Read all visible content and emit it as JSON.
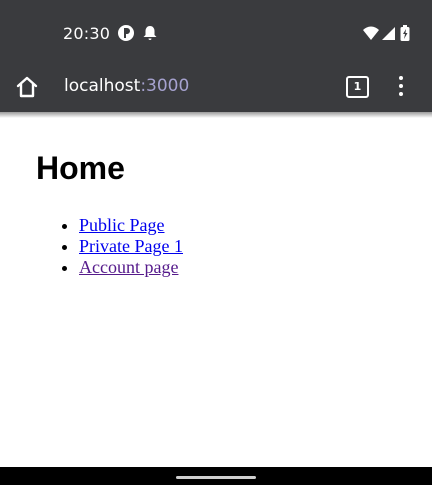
{
  "status_bar": {
    "time": "20:30",
    "icons": [
      "mobile-data-icon",
      "notification-bell-icon",
      "wifi-icon",
      "signal-icon",
      "battery-icon"
    ]
  },
  "browser": {
    "url_host": "localhost",
    "url_port": ":3000",
    "tab_count": "1"
  },
  "page": {
    "title": "Home",
    "links": [
      {
        "label": "Public Page",
        "color": "#0000ee"
      },
      {
        "label": "Private Page 1",
        "color": "#0000ee"
      },
      {
        "label": "Account page",
        "color": "#551a8b"
      }
    ]
  },
  "colors": {
    "chrome_bg": "#3a3b3e",
    "link": "#0000ee",
    "visited_link": "#551a8b",
    "port_text": "#a6a2cf"
  }
}
